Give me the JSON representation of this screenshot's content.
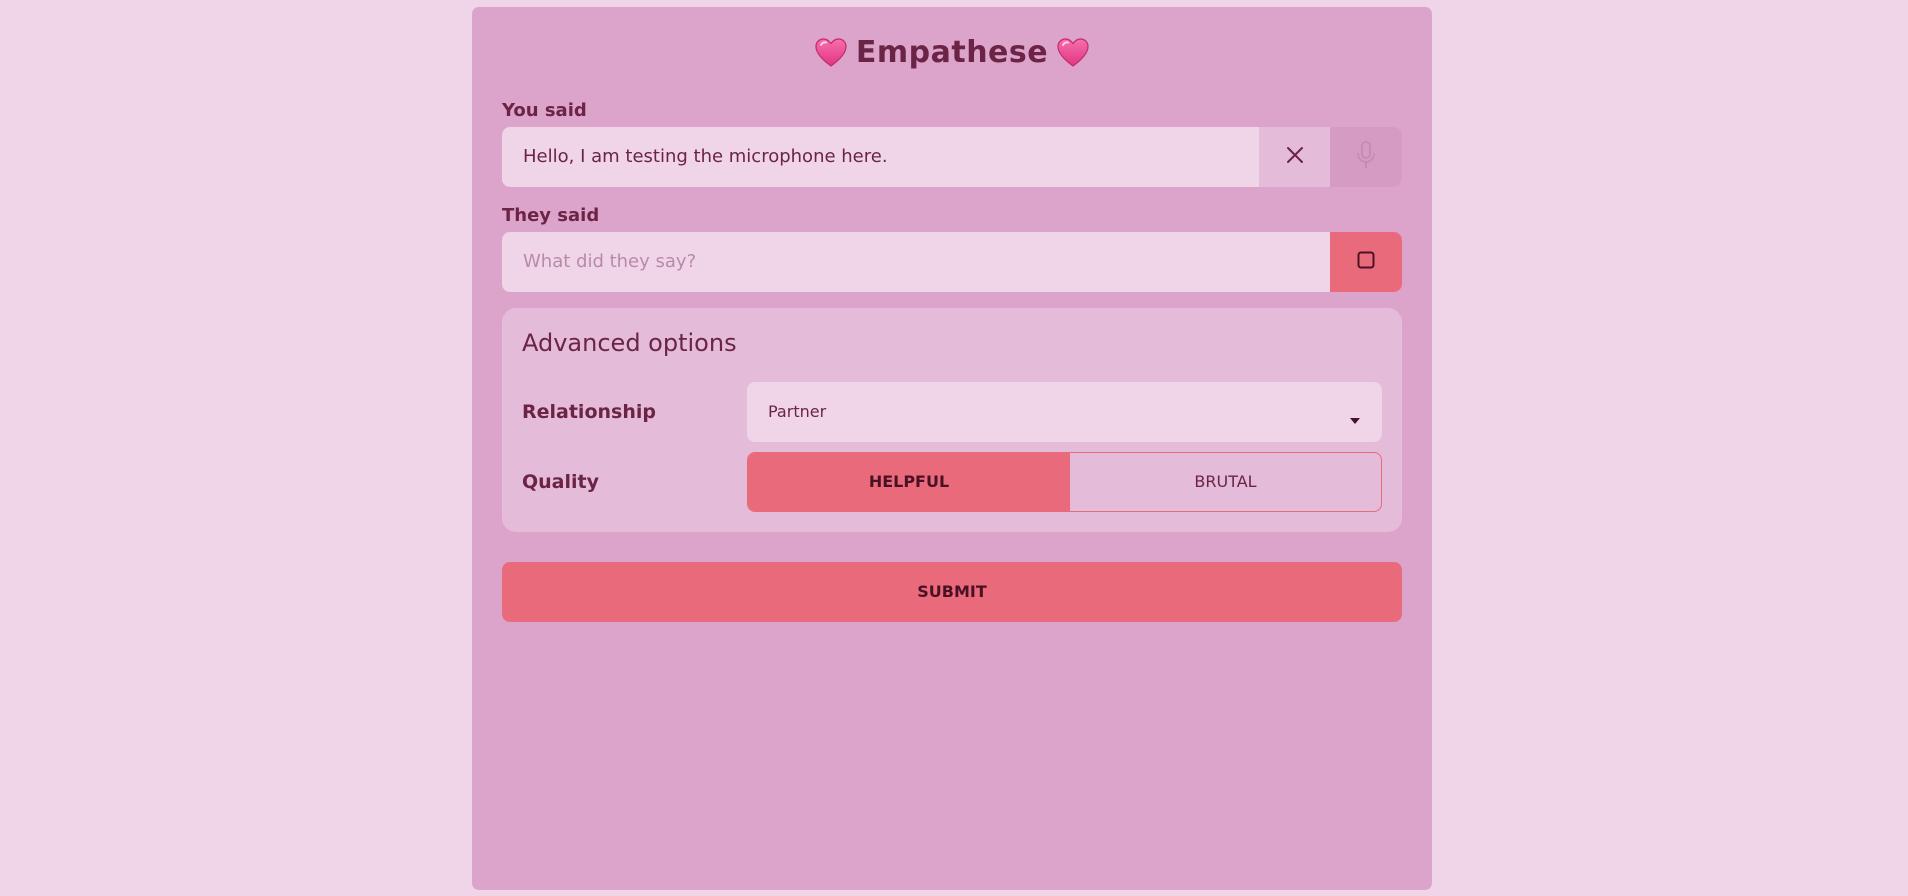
{
  "app": {
    "title": "Empathese",
    "title_icon": "heart-icon",
    "accent_color": "#e96b7b",
    "background_color": "#f0d5e8",
    "card_color": "#dca3cb"
  },
  "you_said": {
    "label": "You said",
    "value": "Hello, I am testing the microphone here.",
    "clear_icon": "close-icon",
    "mic_icon": "microphone-icon"
  },
  "they_said": {
    "label": "They said",
    "placeholder": "What did they say?",
    "value": "",
    "stop_icon": "stop-icon"
  },
  "advanced": {
    "title": "Advanced options",
    "relationship": {
      "label": "Relationship",
      "selected": "Partner"
    },
    "quality": {
      "label": "Quality",
      "options": [
        "HELPFUL",
        "BRUTAL"
      ],
      "selected": "HELPFUL"
    }
  },
  "submit": {
    "label": "SUBMIT"
  }
}
